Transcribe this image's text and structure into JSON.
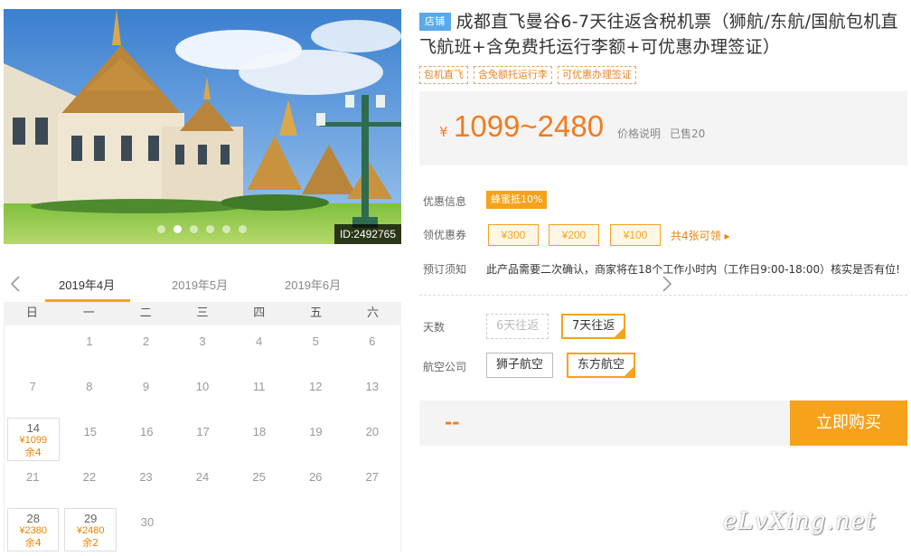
{
  "hero": {
    "id_label": "ID:2492765",
    "dots": 6,
    "active_dot": 1
  },
  "calendar": {
    "months": [
      "2019年4月",
      "2019年5月",
      "2019年6月"
    ],
    "active_month": 0,
    "weekdays": [
      "日",
      "一",
      "二",
      "三",
      "四",
      "五",
      "六"
    ],
    "weeks": [
      [
        {
          "d": ""
        },
        {
          "d": "1"
        },
        {
          "d": "2"
        },
        {
          "d": "3"
        },
        {
          "d": "4"
        },
        {
          "d": "5"
        },
        {
          "d": "6"
        }
      ],
      [
        {
          "d": "7"
        },
        {
          "d": "8"
        },
        {
          "d": "9"
        },
        {
          "d": "10"
        },
        {
          "d": "11"
        },
        {
          "d": "12"
        },
        {
          "d": "13"
        }
      ],
      [
        {
          "d": "14",
          "price": "¥1099",
          "stock": "余4"
        },
        {
          "d": "15"
        },
        {
          "d": "16"
        },
        {
          "d": "17"
        },
        {
          "d": "18"
        },
        {
          "d": "19"
        },
        {
          "d": "20"
        }
      ],
      [
        {
          "d": "21"
        },
        {
          "d": "22"
        },
        {
          "d": "23"
        },
        {
          "d": "24"
        },
        {
          "d": "25"
        },
        {
          "d": "26"
        },
        {
          "d": "27"
        }
      ],
      [
        {
          "d": "28",
          "price": "¥2380",
          "stock": "余4"
        },
        {
          "d": "29",
          "price": "¥2480",
          "stock": "余2"
        },
        {
          "d": "30"
        },
        {
          "d": ""
        },
        {
          "d": ""
        },
        {
          "d": ""
        },
        {
          "d": ""
        }
      ]
    ]
  },
  "product": {
    "shop_badge": "店铺",
    "title": "成都直飞曼谷6-7天往返含税机票（狮航/东航/国航包机直飞航班+含免费托运行李额+可优惠办理签证）",
    "tags": [
      "包机直飞",
      "含免额托运行李",
      "可优惠办理签证"
    ],
    "price_symbol": "¥",
    "price_range": "1099~2480",
    "price_explain": "价格说明",
    "sold": "已售20"
  },
  "promo": {
    "label": "优惠信息",
    "badge": "蜂蜜抵10%"
  },
  "coupons": {
    "label": "领优惠券",
    "items": [
      "¥300",
      "¥200",
      "¥100"
    ],
    "more": "共4张可领 ▸"
  },
  "booking": {
    "label": "预订须知",
    "notice": "此产品需要二次确认，商家将在18个工作小时内（工作日9:00-18:00）核实是否有位!"
  },
  "options": {
    "days_label": "天数",
    "days": [
      "6天往返",
      "7天往返"
    ],
    "airline_label": "航空公司",
    "airlines": [
      "狮子航空",
      "东方航空"
    ]
  },
  "buy": {
    "total": "--",
    "button": "立即购买"
  },
  "watermark": "eLvXing.net",
  "colors": {
    "accent": "#f7a21b",
    "price": "#f37b1d",
    "badge_blue": "#5aa9ea"
  }
}
